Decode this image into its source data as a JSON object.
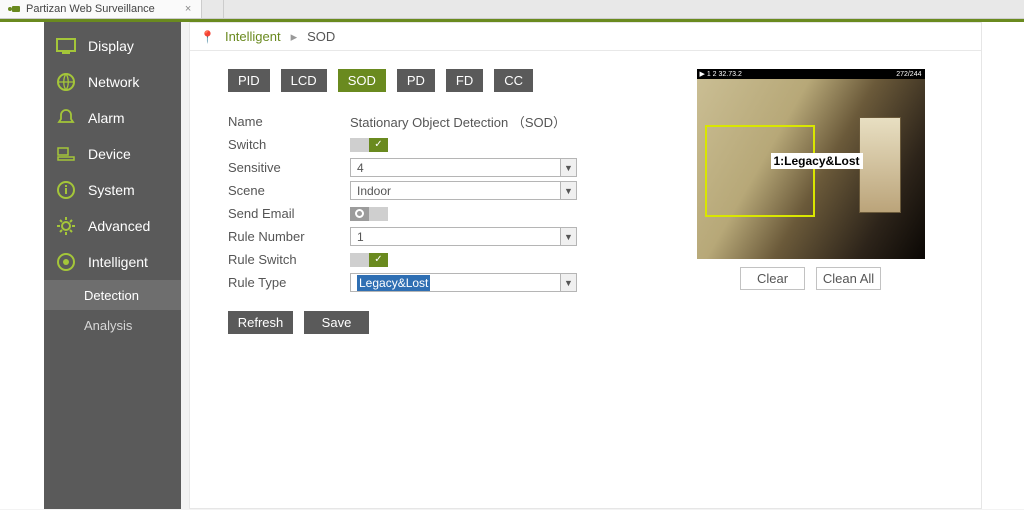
{
  "browser": {
    "tab_title": "Partizan Web Surveillance"
  },
  "sidebar": {
    "items": [
      {
        "label": "Display"
      },
      {
        "label": "Network"
      },
      {
        "label": "Alarm"
      },
      {
        "label": "Device"
      },
      {
        "label": "System"
      },
      {
        "label": "Advanced"
      },
      {
        "label": "Intelligent"
      }
    ],
    "sub": [
      {
        "label": "Detection"
      },
      {
        "label": "Analysis"
      }
    ]
  },
  "breadcrumb": {
    "a": "Intelligent",
    "b": "SOD"
  },
  "tabs": [
    "PID",
    "LCD",
    "SOD",
    "PD",
    "FD",
    "CC"
  ],
  "tabs_active": "SOD",
  "form": {
    "name_label": "Name",
    "name_value": "Stationary Object Detection （SOD）",
    "switch_label": "Switch",
    "switch_on": true,
    "sensitive_label": "Sensitive",
    "sensitive_value": "4",
    "scene_label": "Scene",
    "scene_value": "Indoor",
    "sendemail_label": "Send Email",
    "sendemail_on": false,
    "rulenum_label": "Rule Number",
    "rulenum_value": "1",
    "ruleswitch_label": "Rule Switch",
    "ruleswitch_on": true,
    "ruletype_label": "Rule Type",
    "ruletype_value": "Legacy&Lost"
  },
  "buttons": {
    "refresh": "Refresh",
    "save": "Save",
    "clear": "Clear",
    "cleanall": "Clean All"
  },
  "video": {
    "top_left": "▶ 1 2 32.73.2",
    "top_right": "272/244",
    "roi_label": "1:Legacy&Lost"
  }
}
